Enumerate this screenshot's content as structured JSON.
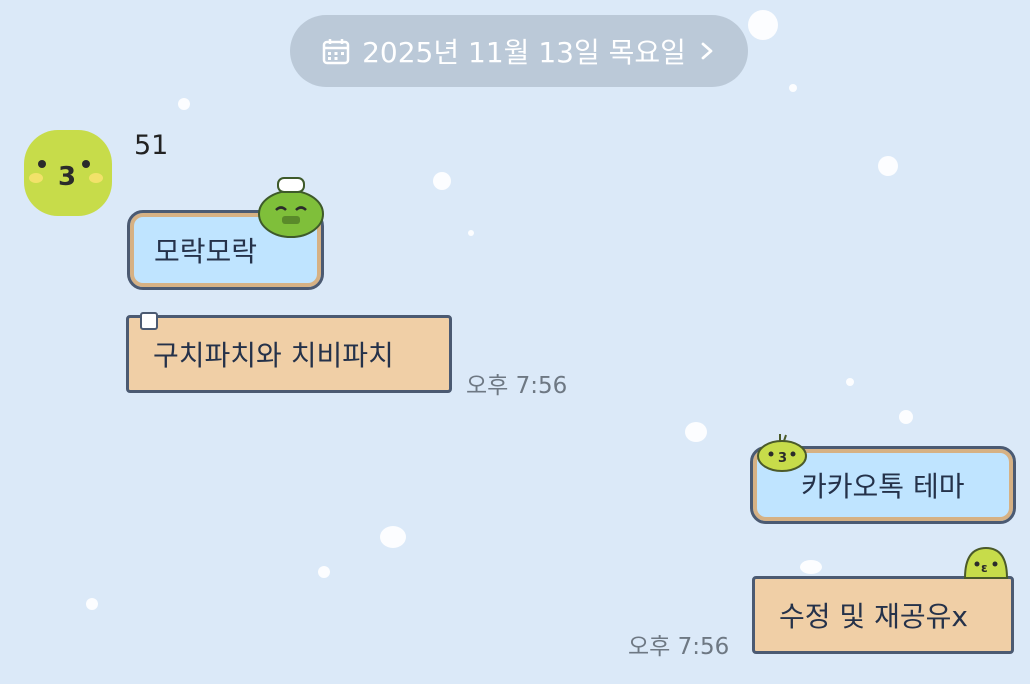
{
  "date_header": {
    "icon": "calendar-icon",
    "text": "2025년 11월 13일 목요일",
    "chevron_icon": "chevron-right-icon"
  },
  "received": {
    "sender_name": "51",
    "avatar_icon": "yellow-chick-face-icon",
    "messages": [
      {
        "text": "모락모락",
        "style": "blue",
        "sticker_icon": "green-frog-chef-icon"
      },
      {
        "text": "구치파치와 치비파치",
        "style": "tan",
        "time": "오후 7:56"
      }
    ]
  },
  "sent": {
    "messages": [
      {
        "text": "카카오톡 테마",
        "style": "blue",
        "sticker_icon": "yellow-chick-icon"
      },
      {
        "text": "수정 및 재공유x",
        "style": "tan",
        "sticker_icon": "yellow-chick-peek-icon",
        "time": "오후 7:56"
      }
    ]
  },
  "colors": {
    "background": "#dbe9f8",
    "bubble_blue": "#bfe4ff",
    "bubble_tan": "#f0cfa6",
    "border": "#4b5a72",
    "text": "#25324a",
    "time": "#6e7883"
  }
}
